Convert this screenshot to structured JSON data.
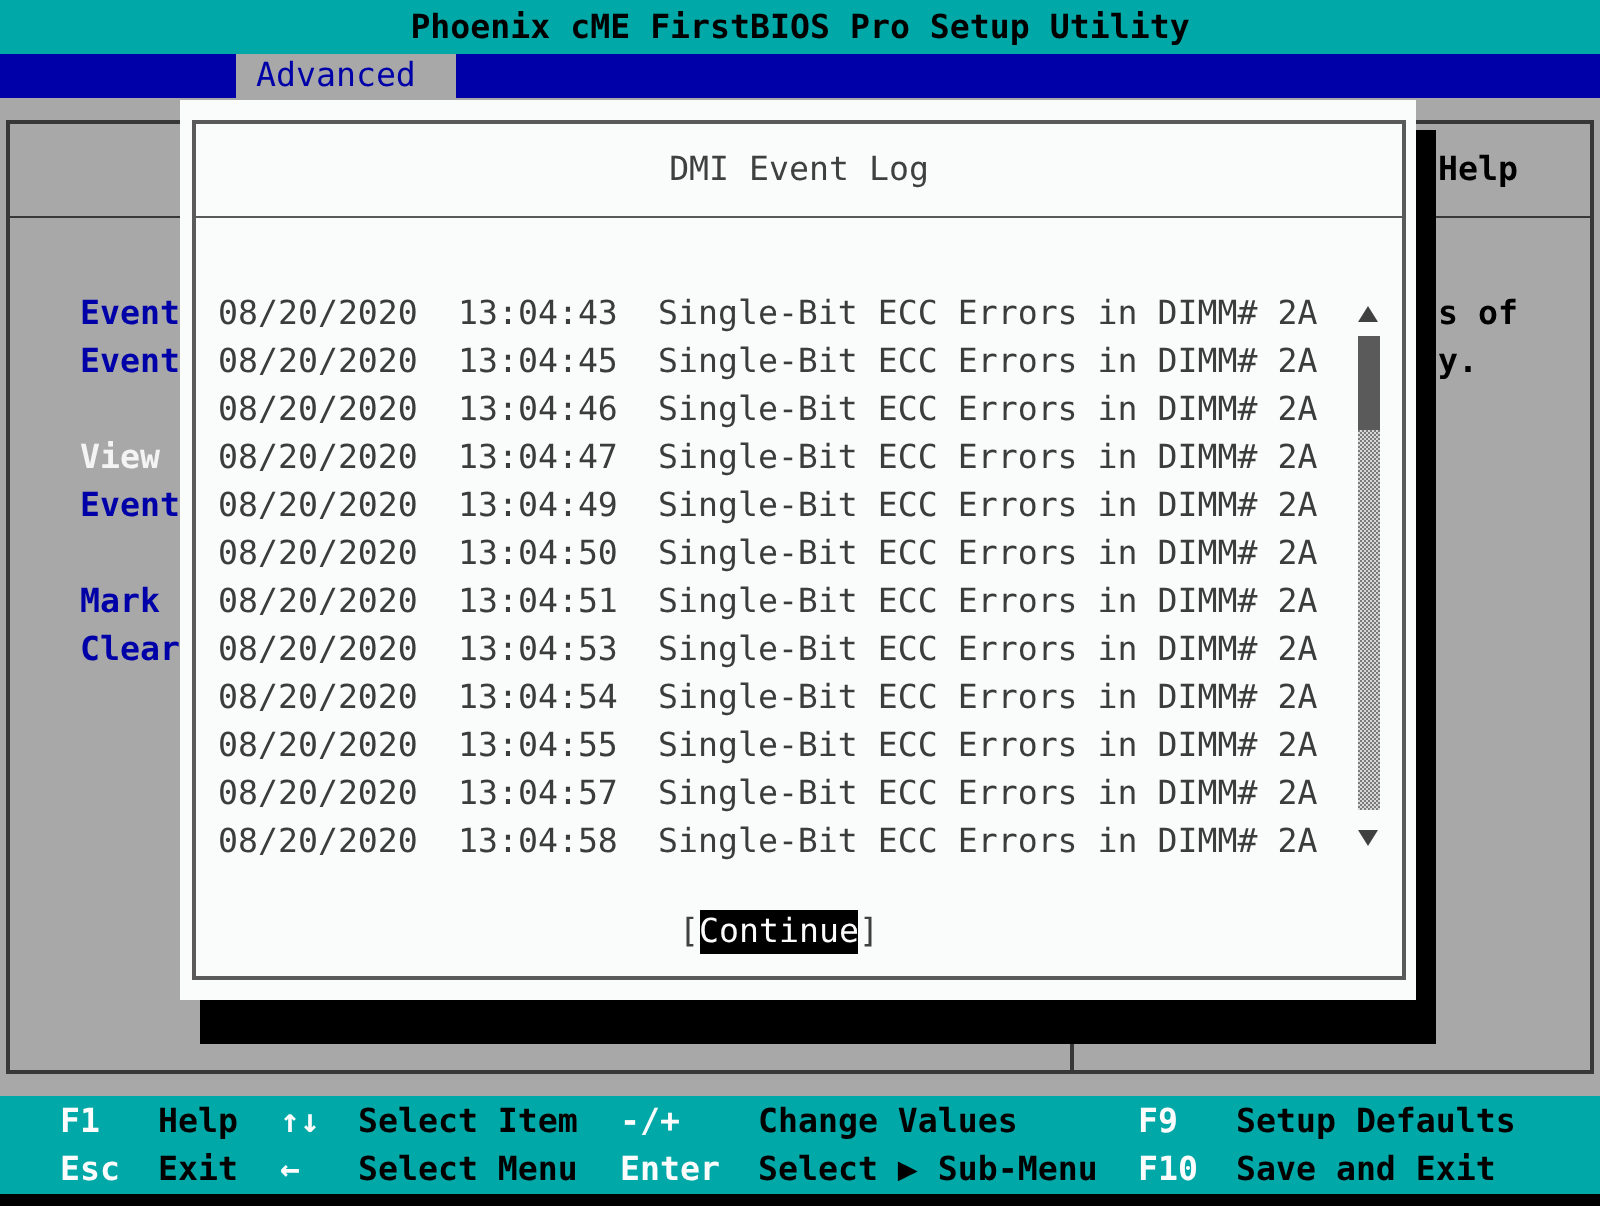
{
  "title": "Phoenix cME FirstBIOS Pro Setup Utility",
  "menu_tabs": [
    {
      "label": "Advanced",
      "selected": true
    }
  ],
  "settings_panel": {
    "item_groups": [
      [
        {
          "label": "Event",
          "selected": false
        },
        {
          "label": "Event",
          "selected": false
        }
      ],
      [
        {
          "label": "View",
          "selected": true
        },
        {
          "label": "Event",
          "selected": false
        }
      ],
      [
        {
          "label": "Mark",
          "selected": false
        },
        {
          "label": "Clear",
          "selected": false
        }
      ]
    ]
  },
  "help_panel": {
    "heading": "Help",
    "lines": [
      "s of",
      "y."
    ]
  },
  "dialog": {
    "title": "DMI Event Log",
    "events": [
      {
        "date": "08/20/2020",
        "time": "13:04:43",
        "message": "Single-Bit ECC Errors in DIMM# 2A"
      },
      {
        "date": "08/20/2020",
        "time": "13:04:45",
        "message": "Single-Bit ECC Errors in DIMM# 2A"
      },
      {
        "date": "08/20/2020",
        "time": "13:04:46",
        "message": "Single-Bit ECC Errors in DIMM# 2A"
      },
      {
        "date": "08/20/2020",
        "time": "13:04:47",
        "message": "Single-Bit ECC Errors in DIMM# 2A"
      },
      {
        "date": "08/20/2020",
        "time": "13:04:49",
        "message": "Single-Bit ECC Errors in DIMM# 2A"
      },
      {
        "date": "08/20/2020",
        "time": "13:04:50",
        "message": "Single-Bit ECC Errors in DIMM# 2A"
      },
      {
        "date": "08/20/2020",
        "time": "13:04:51",
        "message": "Single-Bit ECC Errors in DIMM# 2A"
      },
      {
        "date": "08/20/2020",
        "time": "13:04:53",
        "message": "Single-Bit ECC Errors in DIMM# 2A"
      },
      {
        "date": "08/20/2020",
        "time": "13:04:54",
        "message": "Single-Bit ECC Errors in DIMM# 2A"
      },
      {
        "date": "08/20/2020",
        "time": "13:04:55",
        "message": "Single-Bit ECC Errors in DIMM# 2A"
      },
      {
        "date": "08/20/2020",
        "time": "13:04:57",
        "message": "Single-Bit ECC Errors in DIMM# 2A"
      },
      {
        "date": "08/20/2020",
        "time": "13:04:58",
        "message": "Single-Bit ECC Errors in DIMM# 2A"
      }
    ],
    "button": {
      "left_bracket": "[",
      "label": "Continue",
      "right_bracket": "]",
      "selected": true
    }
  },
  "key_legend": [
    {
      "key": "F1",
      "action": "Help"
    },
    {
      "key": "↑↓",
      "action": "Select Item"
    },
    {
      "key": "-/+",
      "action": "Change Values"
    },
    {
      "key": "F9",
      "action": "Setup Defaults"
    },
    {
      "key": "Esc",
      "action": "Exit"
    },
    {
      "key": "←",
      "action": "Select Menu"
    },
    {
      "key": "Enter",
      "action": "Select ▶ Sub-Menu"
    },
    {
      "key": "F10",
      "action": "Save and Exit"
    }
  ]
}
